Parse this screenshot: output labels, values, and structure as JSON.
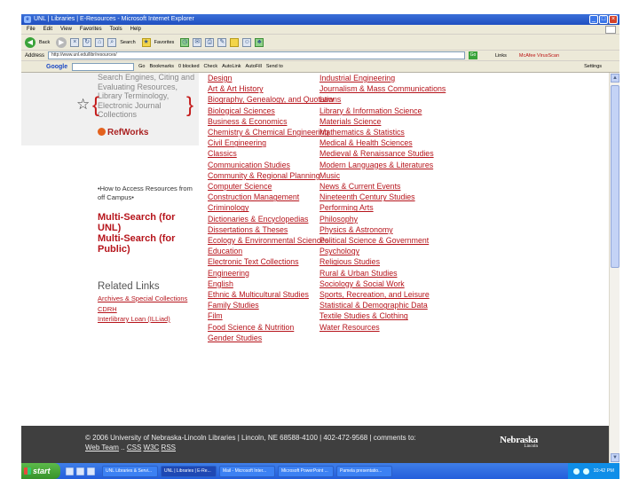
{
  "browser": {
    "title": "UNL | Libraries | E-Resources - Microsoft Internet Explorer",
    "menu": [
      "File",
      "Edit",
      "View",
      "Favorites",
      "Tools",
      "Help"
    ],
    "toolbar": {
      "back": "Back",
      "search": "Search",
      "favorites": "Favorites"
    },
    "address": {
      "label": "Address",
      "url": "http://www.unl.edu/libr/resources/",
      "go": "Go",
      "links": "Links",
      "mcafee": "McAfee VirusScan"
    },
    "google": {
      "logo": "Google",
      "go": "Go",
      "bookmarks": "Bookmarks",
      "blocked": "0 blocked",
      "check": "Check",
      "autolink": "AutoLink",
      "autofill": "AutoFill",
      "send": "Send to",
      "settings": "Settings"
    }
  },
  "sidebar": {
    "resources_text": "Search Engines, Citing and Evaluating Resources, Library Terminology, Electronic Journal Collections",
    "refworks": "RefWorks",
    "how_access": "•How to Access Resources from off Campus•",
    "multisearch_unl": "Multi-Search (for UNL)",
    "multisearch_public": "Multi-Search (for Public)",
    "related_title": "Related Links",
    "related_links": [
      "Archives & Special Collections",
      "CDRH",
      "Interlibrary Loan (ILLiad)"
    ]
  },
  "subjects": {
    "col1": [
      "Design",
      "Art & Art History",
      "Biography, Genealogy, and Quotations",
      "Biological Sciences",
      "Business & Economics",
      "Chemistry & Chemical Engineering",
      "Civil Engineering",
      "Classics",
      "Communication Studies",
      "Community & Regional Planning",
      "Computer Science",
      "Construction Management",
      "Criminology",
      "Dictionaries & Encyclopedias",
      "Dissertations & Theses",
      "Ecology & Environmental Sciences",
      "Education",
      "Electronic Text Collections",
      "Engineering",
      "English",
      "Ethnic & Multicultural Studies",
      "Family Studies",
      "Film",
      "Food Science & Nutrition",
      "Gender Studies"
    ],
    "col2": [
      "Industrial Engineering",
      "Journalism & Mass Communications",
      "Law",
      "Library & Information Science",
      "Materials Science",
      "Mathematics & Statistics",
      "Medical & Health Sciences",
      "Medieval & Renaissance Studies",
      "Modern Languages & Literatures",
      "Music",
      "News & Current Events",
      "Nineteenth Century Studies",
      "Performing Arts",
      "Philosophy",
      "Physics & Astronomy",
      "Political Science & Government",
      "Psychology",
      "Religious Studies",
      "Rural & Urban Studies",
      "Sociology & Social Work",
      "Sports, Recreation, and Leisure",
      "Statistical & Demographic Data",
      "Textile Studies & Clothing",
      "Water Resources"
    ]
  },
  "footer": {
    "line1": "© 2006 University of Nebraska-Lincoln Libraries | Lincoln, NE 68588-4100 | 402-472-9568 | comments to:",
    "web_team": "Web Team",
    "css": "CSS",
    "w3c": "W3C",
    "rss": "RSS",
    "logo_main": "Nebraska",
    "logo_sub": "Lincoln"
  },
  "taskbar": {
    "start": "start",
    "tasks": [
      "UNL Libraries & Servi...",
      "UNL | Libraries | E-Re...",
      "Mail - Microsoft Inter...",
      "Microsoft PowerPoint ...",
      "Pamela presentatio..."
    ],
    "clock": "10:42 PM"
  }
}
